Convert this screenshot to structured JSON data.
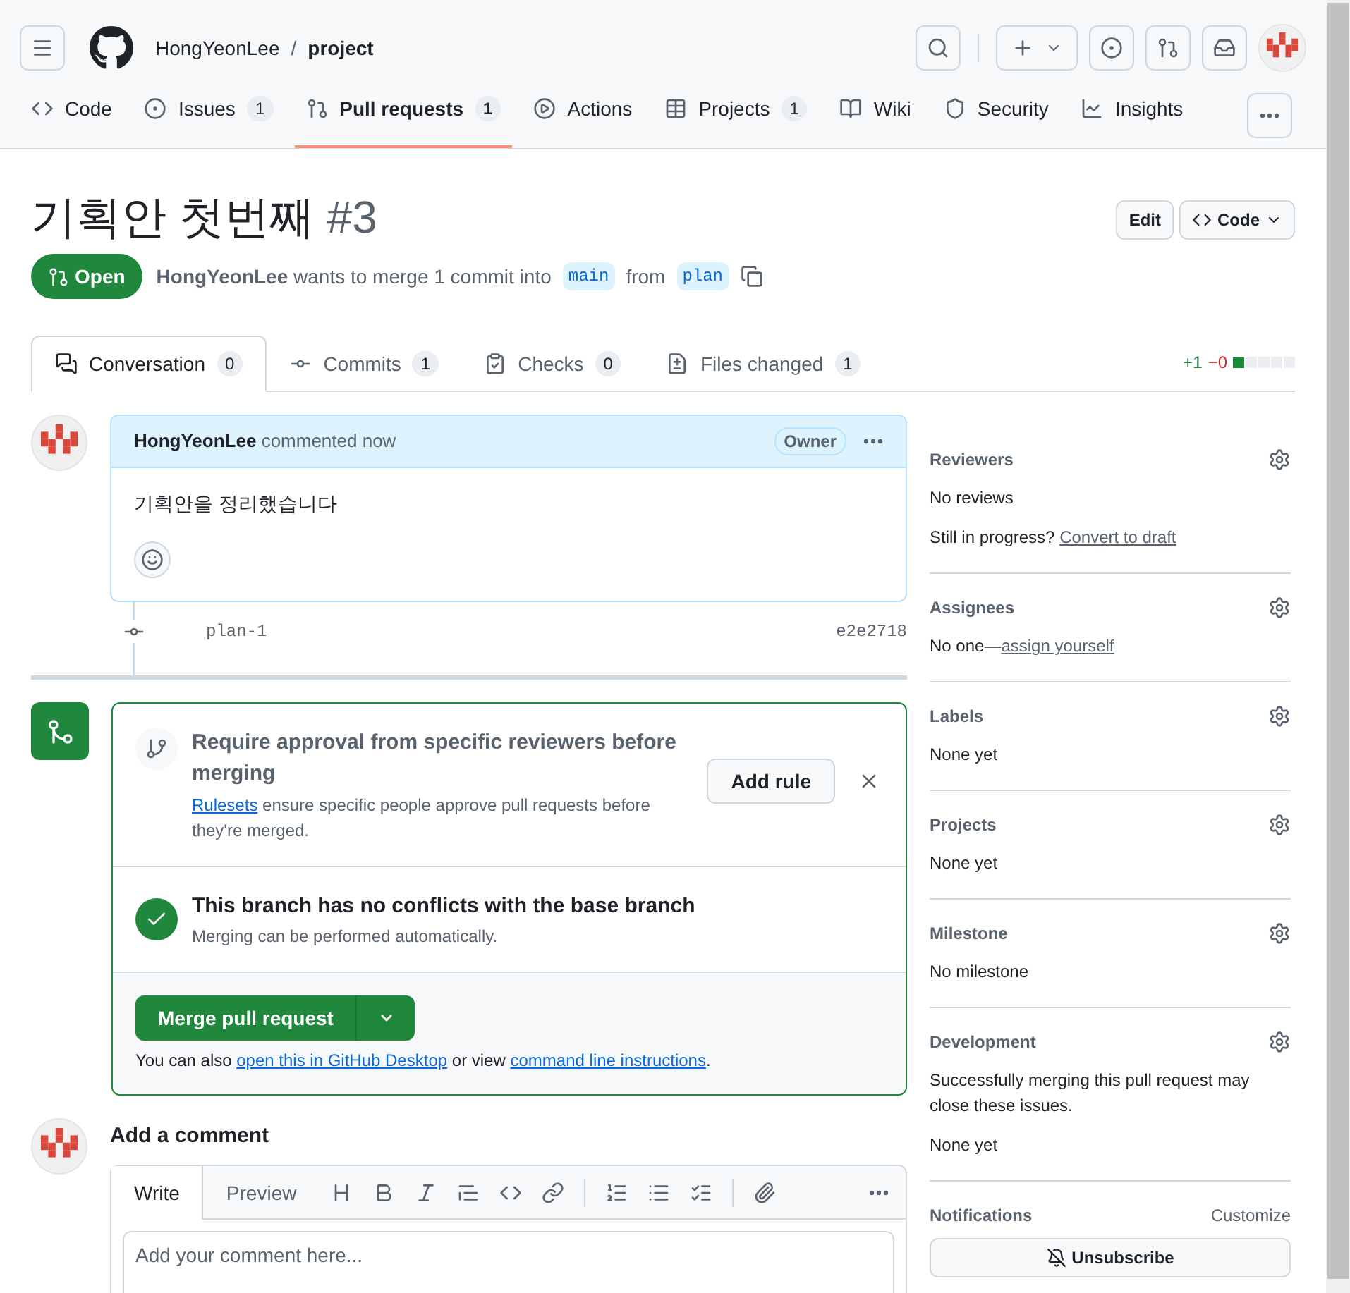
{
  "header": {
    "owner": "HongYeonLee",
    "separator": "/",
    "repo": "project"
  },
  "repo_nav": [
    {
      "kind": "code",
      "label": "Code",
      "selected": false
    },
    {
      "kind": "issues",
      "label": "Issues",
      "count": "1",
      "selected": false
    },
    {
      "kind": "pulls",
      "label": "Pull requests",
      "count": "1",
      "selected": true
    },
    {
      "kind": "actions",
      "label": "Actions",
      "selected": false
    },
    {
      "kind": "projects",
      "label": "Projects",
      "count": "1",
      "selected": false
    },
    {
      "kind": "wiki",
      "label": "Wiki",
      "selected": false
    },
    {
      "kind": "security",
      "label": "Security",
      "selected": false
    },
    {
      "kind": "insights",
      "label": "Insights",
      "selected": false
    }
  ],
  "pr": {
    "title": "기획안 첫번째",
    "number": "#3",
    "edit_button": "Edit",
    "code_button": "Code",
    "state": "Open",
    "author": "HongYeonLee",
    "summary": "wants to merge 1 commit into",
    "base": "main",
    "from_word": "from",
    "head": "plan"
  },
  "pr_tabs": [
    {
      "kind": "conversation",
      "label": "Conversation",
      "count": "0",
      "selected": true
    },
    {
      "kind": "commits",
      "label": "Commits",
      "count": "1",
      "selected": false
    },
    {
      "kind": "checks",
      "label": "Checks",
      "count": "0",
      "selected": false
    },
    {
      "kind": "files",
      "label": "Files changed",
      "count": "1",
      "selected": false
    }
  ],
  "diffstat": {
    "added": "+1",
    "removed": "−0",
    "blocks": [
      {
        "color": "#1f883d"
      },
      {
        "color": "#eaeef2"
      },
      {
        "color": "#eaeef2"
      },
      {
        "color": "#eaeef2"
      },
      {
        "color": "#eaeef2"
      }
    ]
  },
  "comment": {
    "author": "HongYeonLee",
    "action": "commented now",
    "role": "Owner",
    "body": "기획안을 정리했습니다"
  },
  "commit": {
    "message": "plan-1",
    "sha": "e2e2718"
  },
  "merge_box": {
    "rule_title": "Require approval from specific reviewers before merging",
    "rule_link": "Rulesets",
    "rule_text": "ensure specific people approve pull requests before they're merged.",
    "add_rule": "Add rule",
    "status_title": "This branch has no conflicts with the base branch",
    "status_text": "Merging can be performed automatically.",
    "merge_button": "Merge pull request",
    "also_prefix": "You can also",
    "desktop_link": "open this in GitHub Desktop",
    "also_middle": "or view",
    "cli_link": "command line instructions",
    "also_suffix": "."
  },
  "new_comment": {
    "heading": "Add a comment",
    "tabs": [
      {
        "label": "Write",
        "selected": true
      },
      {
        "label": "Preview",
        "selected": false
      }
    ],
    "placeholder": "Add your comment here..."
  },
  "sidebar": [
    {
      "title": "Reviewers",
      "content": [
        {
          "text": "No reviews"
        },
        {
          "text": "Still in progress?",
          "link": "Convert to draft"
        }
      ]
    },
    {
      "title": "Assignees",
      "content": [
        {
          "text": "No one—",
          "link": "assign yourself"
        }
      ]
    },
    {
      "title": "Labels",
      "content": [
        {
          "text": "None yet"
        }
      ]
    },
    {
      "title": "Projects",
      "content": [
        {
          "text": "None yet"
        }
      ]
    },
    {
      "title": "Milestone",
      "content": [
        {
          "text": "No milestone"
        }
      ]
    },
    {
      "title": "Development",
      "content": [
        {
          "text": "Successfully merging this pull request may close these issues."
        },
        {
          "text": "None yet"
        }
      ]
    }
  ],
  "notifications": {
    "title": "Notifications",
    "customize": "Customize",
    "button": "Unsubscribe"
  }
}
